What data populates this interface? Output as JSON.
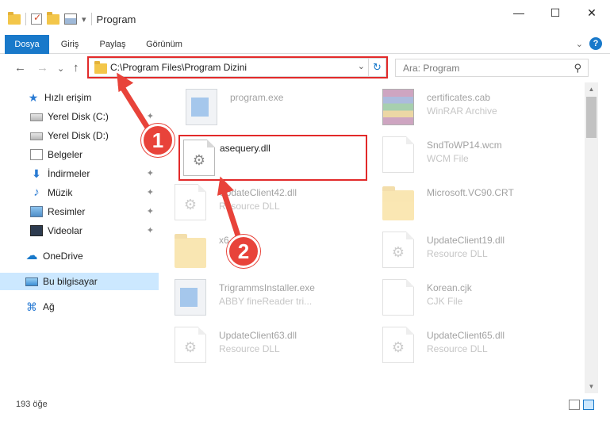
{
  "window": {
    "title": "Program",
    "controls": {
      "minimize": "—",
      "maximize": "☐",
      "close": "✕"
    }
  },
  "qat": {
    "dropdown": "▾"
  },
  "ribbon": {
    "tabs": [
      "Dosya",
      "Giriş",
      "Paylaş",
      "Görünüm"
    ],
    "collapse": "⌄",
    "help": "?"
  },
  "nav": {
    "back": "←",
    "forward": "→",
    "recent": "⌄",
    "up": "↑",
    "address": "C:\\Program Files\\Program Dizini",
    "address_dropdown": "⌄",
    "refresh": "↻",
    "search_placeholder": "Ara: Program",
    "search_icon": "⚲"
  },
  "sidebar": {
    "items": [
      {
        "label": "Hızlı erişim",
        "icon": "star-icon",
        "glyph": "★",
        "pinned": false
      },
      {
        "label": "Yerel Disk (C:)",
        "icon": "drive-icon",
        "glyph": "",
        "pinned": true
      },
      {
        "label": "Yerel Disk (D:)",
        "icon": "drive-icon",
        "glyph": "",
        "pinned": false
      },
      {
        "label": "Belgeler",
        "icon": "documents-icon",
        "glyph": "",
        "pinned": true
      },
      {
        "label": "İndirmeler",
        "icon": "download-icon",
        "glyph": "⬇",
        "pinned": true
      },
      {
        "label": "Müzik",
        "icon": "music-icon",
        "glyph": "♪",
        "pinned": true
      },
      {
        "label": "Resimler",
        "icon": "pictures-icon",
        "glyph": "",
        "pinned": true
      },
      {
        "label": "Videolar",
        "icon": "videos-icon",
        "glyph": "",
        "pinned": true
      },
      {
        "label": "OneDrive",
        "icon": "cloud-icon",
        "glyph": "☁",
        "pinned": false
      },
      {
        "label": "Bu bilgisayar",
        "icon": "computer-icon",
        "glyph": "",
        "pinned": false
      },
      {
        "label": "Ağ",
        "icon": "network-icon",
        "glyph": "⌘",
        "pinned": false
      }
    ],
    "pin_glyph": "📌"
  },
  "files": [
    {
      "name": "program.exe",
      "type": "",
      "icon": "exe-icon",
      "faded": true
    },
    {
      "name": "certificates.cab",
      "type": "WinRAR Archive",
      "icon": "archive-icon",
      "faded": true
    },
    {
      "name": "asequery.dll",
      "type": "",
      "icon": "dll-icon",
      "faded": false
    },
    {
      "name": "SndToWP14.wcm",
      "type": "WCM File",
      "icon": "document-icon",
      "faded": true
    },
    {
      "name": "UpdateClient42.dll",
      "type": "Resource DLL",
      "icon": "dll-icon",
      "faded": true
    },
    {
      "name": "Microsoft.VC90.CRT",
      "type": "",
      "icon": "folder-icon",
      "faded": true
    },
    {
      "name": "x6",
      "type": "",
      "icon": "folder-icon",
      "faded": true
    },
    {
      "name": "UpdateClient19.dll",
      "type": "Resource DLL",
      "icon": "dll-icon",
      "faded": true
    },
    {
      "name": "TrigrammsInstaller.exe",
      "type": "ABBY fineReader tri...",
      "icon": "exe-icon",
      "faded": true
    },
    {
      "name": "Korean.cjk",
      "type": "CJK File",
      "icon": "document-icon",
      "faded": true
    },
    {
      "name": "UpdateClient63.dll",
      "type": "Resource DLL",
      "icon": "dll-icon",
      "faded": true
    },
    {
      "name": "UpdateClient65.dll",
      "type": "Resource DLL",
      "icon": "dll-icon",
      "faded": true
    }
  ],
  "gear_glyph": "⚙",
  "scroll": {
    "up": "▲",
    "down": "▼"
  },
  "status": {
    "count": "193 öğe"
  },
  "annotations": [
    {
      "number": "1"
    },
    {
      "number": "2"
    }
  ],
  "colors": {
    "accent": "#1979ca",
    "highlight_red": "#e22a2a",
    "selected_bg": "#cce8ff"
  }
}
